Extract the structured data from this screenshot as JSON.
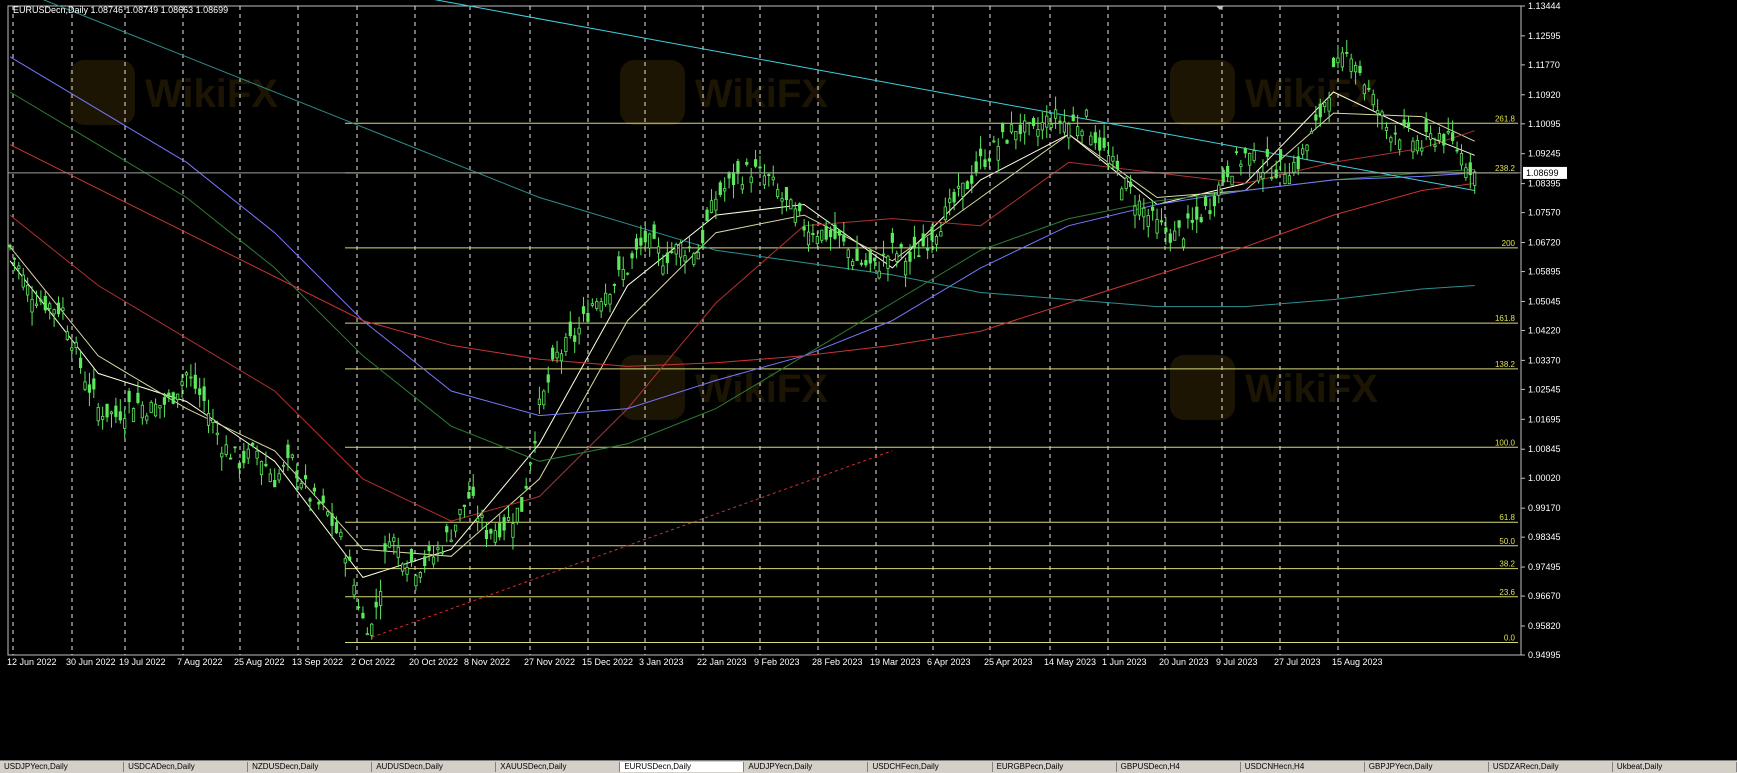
{
  "window": {
    "title": "EURUSDecn,Daily  1.08746 1.08749 1.08663 1.08699"
  },
  "chart_data": {
    "type": "candlestick",
    "symbol": "EURUSDecn",
    "timeframe": "Daily",
    "ohlc_readout": {
      "open": 1.08746,
      "high": 1.08749,
      "low": 1.08663,
      "close": 1.08699
    },
    "current_price_label": "1.08699",
    "y_tick_labels": [
      "1.13444",
      "1.12595",
      "1.11770",
      "1.10920",
      "1.10095",
      "1.09245",
      "1.08395",
      "1.07570",
      "1.06720",
      "1.05895",
      "1.05045",
      "1.04220",
      "1.03370",
      "1.02545",
      "1.01695",
      "1.00845",
      "1.00020",
      "0.99170",
      "0.98345",
      "0.97495",
      "0.96670",
      "0.95820",
      "0.94995"
    ],
    "ylim": [
      0.94995,
      1.13444
    ],
    "x_tick_labels": [
      "12 Jun 2022",
      "30 Jun 2022",
      "19 Jul 2022",
      "7 Aug 2022",
      "25 Aug 2022",
      "13 Sep 2022",
      "2 Oct 2022",
      "20 Oct 2022",
      "8 Nov 2022",
      "27 Nov 2022",
      "15 Dec 2022",
      "3 Jan 2023",
      "22 Jan 2023",
      "9 Feb 2023",
      "28 Feb 2023",
      "19 Mar 2023",
      "6 Apr 2023",
      "25 Apr 2023",
      "14 May 2023",
      "1 Jun 2023",
      "20 Jun 2023",
      "9 Jul 2023",
      "27 Jul 2023",
      "15 Aug 2023"
    ],
    "fibonacci_levels": [
      {
        "label": "261.8",
        "price": 1.1011
      },
      {
        "label": "238.2",
        "price": 1.087
      },
      {
        "label": "200",
        "price": 1.0657
      },
      {
        "label": "161.8",
        "price": 1.0443
      },
      {
        "label": "138.2",
        "price": 1.0313
      },
      {
        "label": "100.0",
        "price": 1.009
      },
      {
        "label": "61.8",
        "price": 0.9877
      },
      {
        "label": "50.0",
        "price": 0.981
      },
      {
        "label": "38.2",
        "price": 0.9745
      },
      {
        "label": "23.6",
        "price": 0.9665
      },
      {
        "label": "0.0",
        "price": 0.9535
      }
    ],
    "price_path": [
      [
        0,
        1.066
      ],
      [
        2,
        1.054
      ],
      [
        4,
        1.05
      ],
      [
        6,
        1.048
      ],
      [
        8,
        1.032
      ],
      [
        10,
        1.02
      ],
      [
        12,
        1.018
      ],
      [
        14,
        1.022
      ],
      [
        16,
        1.02
      ],
      [
        18,
        1.022
      ],
      [
        20,
        1.03
      ],
      [
        22,
        1.022
      ],
      [
        24,
        1.01
      ],
      [
        26,
        1.005
      ],
      [
        28,
        1.008
      ],
      [
        30,
        1.0
      ],
      [
        32,
        1.005
      ],
      [
        34,
        0.995
      ],
      [
        36,
        0.99
      ],
      [
        38,
        0.98
      ],
      [
        40,
        0.96
      ],
      [
        41,
        0.958
      ],
      [
        42,
        0.97
      ],
      [
        43,
        0.985
      ],
      [
        44,
        0.98
      ],
      [
        46,
        0.975
      ],
      [
        48,
        0.978
      ],
      [
        50,
        0.985
      ],
      [
        52,
        0.995
      ],
      [
        54,
        0.985
      ],
      [
        56,
        0.987
      ],
      [
        58,
        0.992
      ],
      [
        60,
        1.02
      ],
      [
        62,
        1.035
      ],
      [
        64,
        1.04
      ],
      [
        66,
        1.05
      ],
      [
        68,
        1.055
      ],
      [
        70,
        1.06
      ],
      [
        72,
        1.068
      ],
      [
        74,
        1.063
      ],
      [
        76,
        1.066
      ],
      [
        78,
        1.065
      ],
      [
        80,
        1.08
      ],
      [
        82,
        1.085
      ],
      [
        84,
        1.088
      ],
      [
        86,
        1.085
      ],
      [
        88,
        1.078
      ],
      [
        90,
        1.072
      ],
      [
        92,
        1.07
      ],
      [
        94,
        1.068
      ],
      [
        96,
        1.062
      ],
      [
        98,
        1.06
      ],
      [
        100,
        1.065
      ],
      [
        102,
        1.062
      ],
      [
        104,
        1.068
      ],
      [
        106,
        1.075
      ],
      [
        108,
        1.082
      ],
      [
        110,
        1.09
      ],
      [
        112,
        1.095
      ],
      [
        114,
        1.1
      ],
      [
        116,
        1.098
      ],
      [
        118,
        1.103
      ],
      [
        120,
        1.101
      ],
      [
        122,
        1.102
      ],
      [
        124,
        1.093
      ],
      [
        126,
        1.085
      ],
      [
        128,
        1.078
      ],
      [
        130,
        1.072
      ],
      [
        132,
        1.069
      ],
      [
        134,
        1.072
      ],
      [
        136,
        1.078
      ],
      [
        138,
        1.088
      ],
      [
        140,
        1.092
      ],
      [
        142,
        1.089
      ],
      [
        144,
        1.088
      ],
      [
        146,
        1.09
      ],
      [
        148,
        1.1
      ],
      [
        150,
        1.115
      ],
      [
        152,
        1.122
      ],
      [
        154,
        1.11
      ],
      [
        156,
        1.1
      ],
      [
        158,
        1.098
      ],
      [
        160,
        1.095
      ],
      [
        162,
        1.098
      ],
      [
        164,
        1.094
      ],
      [
        166,
        1.087
      ]
    ],
    "moving_averages": [
      {
        "color": "#ffffe0",
        "points": [
          [
            0,
            1.062
          ],
          [
            10,
            1.03
          ],
          [
            20,
            1.022
          ],
          [
            30,
            1.005
          ],
          [
            40,
            0.972
          ],
          [
            50,
            0.98
          ],
          [
            60,
            1.01
          ],
          [
            70,
            1.055
          ],
          [
            80,
            1.075
          ],
          [
            90,
            1.078
          ],
          [
            100,
            1.06
          ],
          [
            110,
            1.085
          ],
          [
            120,
            1.098
          ],
          [
            130,
            1.078
          ],
          [
            140,
            1.084
          ],
          [
            150,
            1.11
          ],
          [
            160,
            1.098
          ],
          [
            166,
            1.092
          ]
        ]
      },
      {
        "color": "#d8d8a0",
        "points": [
          [
            0,
            1.066
          ],
          [
            10,
            1.035
          ],
          [
            20,
            1.02
          ],
          [
            30,
            1.008
          ],
          [
            40,
            0.98
          ],
          [
            50,
            0.978
          ],
          [
            60,
            1.0
          ],
          [
            70,
            1.045
          ],
          [
            80,
            1.07
          ],
          [
            90,
            1.075
          ],
          [
            100,
            1.062
          ],
          [
            110,
            1.08
          ],
          [
            120,
            1.098
          ],
          [
            130,
            1.08
          ],
          [
            140,
            1.082
          ],
          [
            150,
            1.104
          ],
          [
            160,
            1.103
          ],
          [
            166,
            1.096
          ]
        ]
      },
      {
        "color": "#b03030",
        "points": [
          [
            0,
            1.075
          ],
          [
            10,
            1.055
          ],
          [
            20,
            1.04
          ],
          [
            30,
            1.025
          ],
          [
            40,
            1.0
          ],
          [
            50,
            0.988
          ],
          [
            60,
            0.995
          ],
          [
            70,
            1.02
          ],
          [
            80,
            1.05
          ],
          [
            90,
            1.072
          ],
          [
            100,
            1.074
          ],
          [
            110,
            1.072
          ],
          [
            120,
            1.09
          ],
          [
            130,
            1.087
          ],
          [
            140,
            1.084
          ],
          [
            150,
            1.09
          ],
          [
            160,
            1.094
          ],
          [
            166,
            1.099
          ]
        ]
      },
      {
        "color": "#2e7d32",
        "points": [
          [
            0,
            1.11
          ],
          [
            10,
            1.095
          ],
          [
            20,
            1.08
          ],
          [
            30,
            1.06
          ],
          [
            40,
            1.035
          ],
          [
            50,
            1.015
          ],
          [
            60,
            1.005
          ],
          [
            70,
            1.01
          ],
          [
            80,
            1.02
          ],
          [
            90,
            1.035
          ],
          [
            100,
            1.05
          ],
          [
            110,
            1.065
          ],
          [
            120,
            1.074
          ],
          [
            130,
            1.079
          ],
          [
            140,
            1.082
          ],
          [
            150,
            1.085
          ],
          [
            160,
            1.087
          ],
          [
            166,
            1.088
          ]
        ]
      },
      {
        "color": "#7777ff",
        "points": [
          [
            0,
            1.12
          ],
          [
            10,
            1.105
          ],
          [
            20,
            1.09
          ],
          [
            30,
            1.07
          ],
          [
            40,
            1.045
          ],
          [
            50,
            1.025
          ],
          [
            60,
            1.018
          ],
          [
            70,
            1.02
          ],
          [
            80,
            1.028
          ],
          [
            90,
            1.035
          ],
          [
            100,
            1.045
          ],
          [
            110,
            1.06
          ],
          [
            120,
            1.072
          ],
          [
            130,
            1.078
          ],
          [
            140,
            1.082
          ],
          [
            150,
            1.085
          ],
          [
            160,
            1.086
          ],
          [
            166,
            1.087
          ]
        ]
      },
      {
        "color": "#cc3333",
        "points": [
          [
            0,
            1.095
          ],
          [
            20,
            1.07
          ],
          [
            40,
            1.045
          ],
          [
            50,
            1.038
          ],
          [
            60,
            1.034
          ],
          [
            70,
            1.032
          ],
          [
            80,
            1.033
          ],
          [
            90,
            1.035
          ],
          [
            100,
            1.038
          ],
          [
            110,
            1.042
          ],
          [
            120,
            1.05
          ],
          [
            130,
            1.058
          ],
          [
            140,
            1.066
          ],
          [
            150,
            1.075
          ],
          [
            160,
            1.082
          ],
          [
            166,
            1.084
          ]
        ]
      },
      {
        "color": "#2f8f8f",
        "points": [
          [
            0,
            1.14
          ],
          [
            20,
            1.12
          ],
          [
            40,
            1.1
          ],
          [
            60,
            1.08
          ],
          [
            80,
            1.065
          ],
          [
            100,
            1.058
          ],
          [
            110,
            1.053
          ],
          [
            120,
            1.051
          ],
          [
            130,
            1.049
          ],
          [
            140,
            1.049
          ],
          [
            150,
            1.051
          ],
          [
            160,
            1.054
          ],
          [
            166,
            1.055
          ]
        ]
      }
    ],
    "trendlines": [
      {
        "color": "#40d0e0",
        "dash": false,
        "from": [
          40,
          1.14
        ],
        "to": [
          166,
          1.082
        ]
      },
      {
        "color": "#d03030",
        "dash": true,
        "from": [
          41,
          0.955
        ],
        "to": [
          100,
          1.008
        ]
      }
    ],
    "watermark": "WikiFX",
    "grid": "vertical dashed"
  },
  "bottom_tabs": [
    "USDJPYecn,Daily",
    "USDCADecn,Daily",
    "NZDUSDecn,Daily",
    "AUDUSDecn,Daily",
    "XAUUSDecn,Daily",
    "EURUSDecn,Daily",
    "AUDJPYecn,Daily",
    "USDCHFecn,Daily",
    "EURGBPecn,Daily",
    "GBPUSDecn,H4",
    "USDCNHecn,H4",
    "GBPJPYecn,Daily",
    "USDZARecn,Daily",
    "Ukbeat,Daily"
  ],
  "active_tab": 5
}
